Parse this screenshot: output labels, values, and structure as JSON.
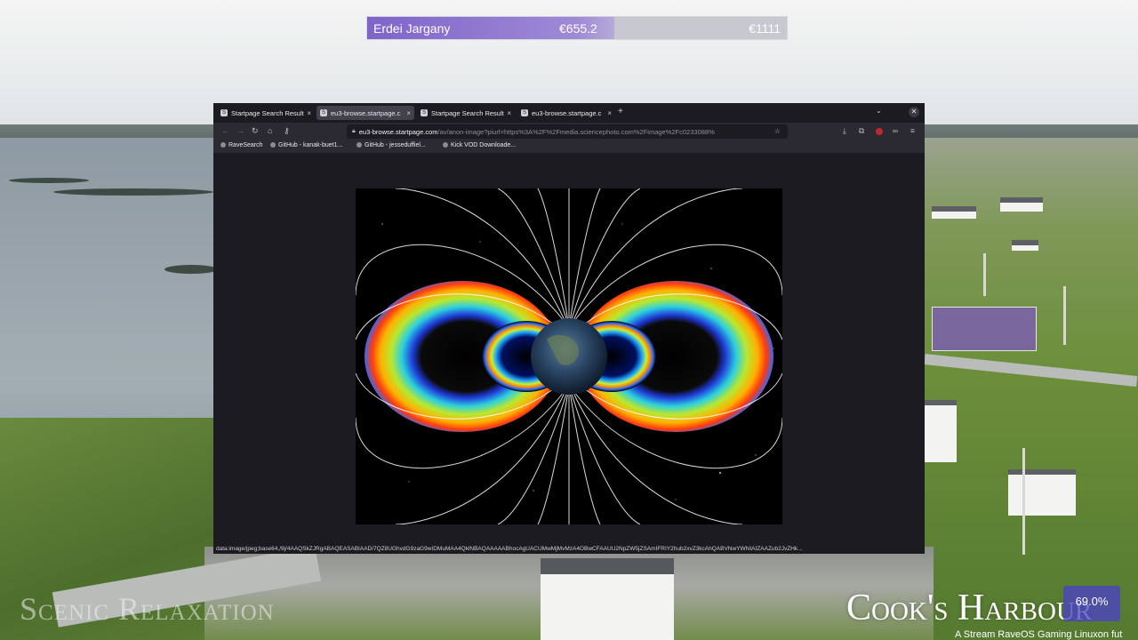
{
  "overlay": {
    "donation_name": "Erdei Jargany",
    "donation_current": "€655.2",
    "donation_goal": "€1111",
    "donation_progress": 0.59,
    "scenic_title": "Scenic Relaxation",
    "location_title": "Cook's Harbour",
    "subtitle": "A Stream RaveOS Gaming Linuxon fut",
    "progress_badge": "69.0%"
  },
  "browser": {
    "tabs": [
      {
        "label": "Startpage Search Result",
        "active": false
      },
      {
        "label": "eu3-browse.startpage.c",
        "active": true
      },
      {
        "label": "Startpage Search Result",
        "active": false
      },
      {
        "label": "eu3-browse.startpage.c",
        "active": false
      }
    ],
    "url_host": "eu3-browse.startpage.com",
    "url_rest": "/av/anon-image?piurl=https%3A%2F%2Fmedia.sciencephoto.com%2Fimage%2Fc0233088%",
    "bookmarks": [
      "RaveSearch",
      "GitHub - kanak-buet1...",
      "GitHub - jesseduffiel...",
      "Kick VOD Downloade..."
    ],
    "status_text": "data:image/jpeg;base64,/9j/4AAQSkZJRgABAQEASABIAAD/7QZ8UGhvdG9zaG9wIDMuMAA4QklNBAQAAAAABhocAgUACUMwMjMvMzA4OBwCFAAUU2NpZW5jZSAmIFRIY2hub2xvZ3kcAhQABVNwYWNIAIZAAZub2JvZHk..."
  },
  "icons": {
    "tab_favicon": "startpage-icon",
    "new_tab": "plus-icon",
    "window_close": "close-icon",
    "back": "back-arrow-icon",
    "forward": "forward-arrow-icon",
    "reload": "reload-icon",
    "home": "home-icon",
    "lock": "lock-icon",
    "bookmark_star": "star-icon",
    "downloads": "download-icon",
    "extensions": "puzzle-icon",
    "menu": "hamburger-menu-icon"
  },
  "colors": {
    "donation_fill": "#7e64c9",
    "browser_bg": "#1c1b22",
    "toolbar_bg": "#2b2a33",
    "badge_bg": "#4840c8"
  }
}
